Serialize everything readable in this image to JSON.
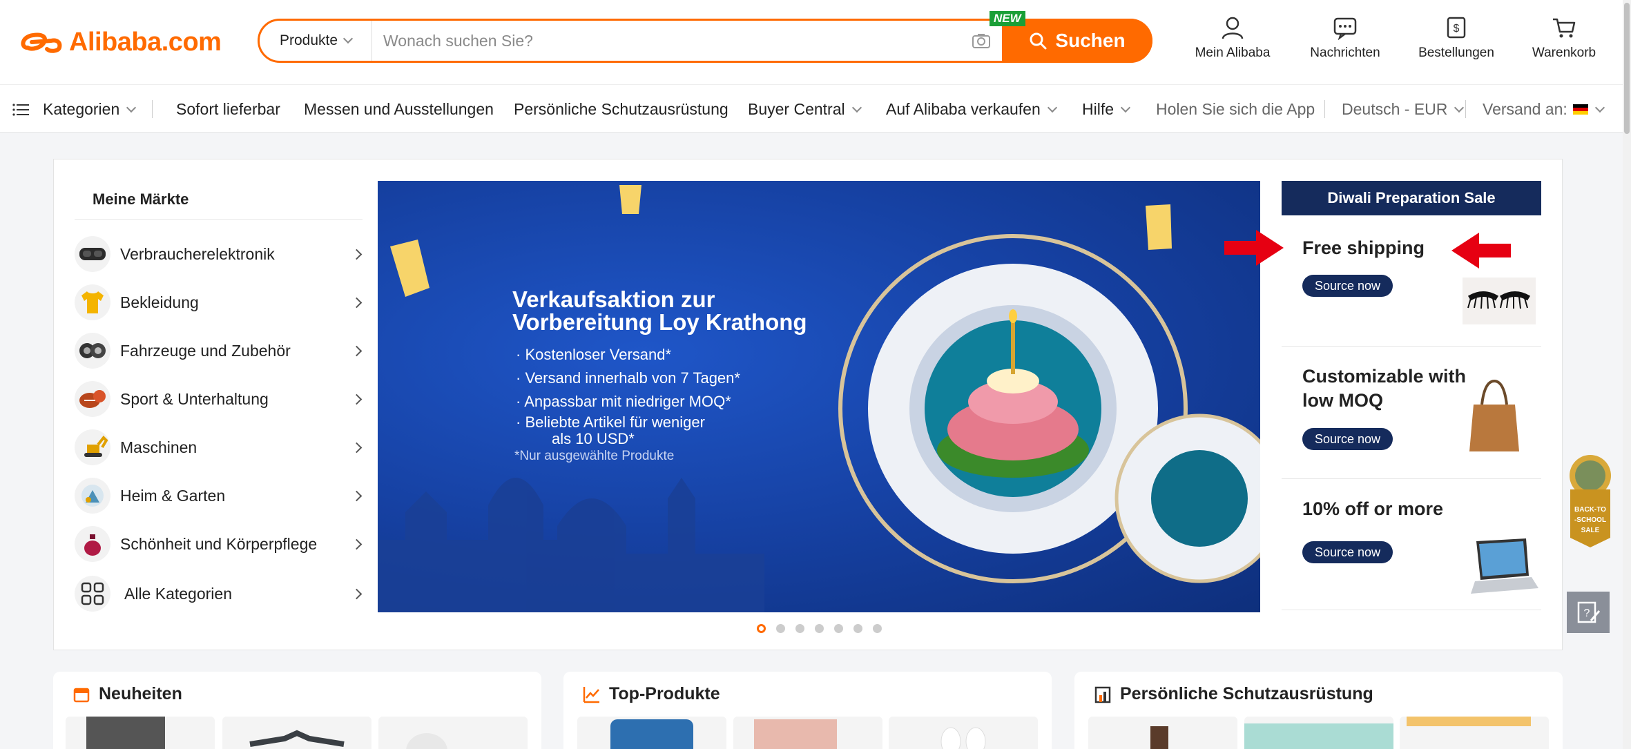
{
  "header": {
    "logo_text": "Alibaba.com",
    "search": {
      "category": "Produkte",
      "placeholder": "Wonach suchen Sie?",
      "button_label": "Suchen",
      "new_badge": "NEW"
    },
    "icons": [
      {
        "label": "Mein Alibaba",
        "icon": "user-icon"
      },
      {
        "label": "Nachrichten",
        "icon": "message-icon"
      },
      {
        "label": "Bestellungen",
        "icon": "orders-icon"
      },
      {
        "label": "Warenkorb",
        "icon": "cart-icon"
      }
    ]
  },
  "nav": {
    "categories": "Kategorien",
    "items": [
      "Sofort lieferbar",
      "Messen und Ausstellungen",
      "Persönliche Schutzausrüstung",
      "Buyer Central",
      "Auf Alibaba verkaufen",
      "Hilfe"
    ],
    "app": "Holen Sie sich die App",
    "language": "Deutsch - EUR",
    "ship_to": "Versand an:"
  },
  "markets": {
    "title": "Meine Märkte",
    "items": [
      {
        "label": "Verbraucherelektronik",
        "icon": "vr-headset-icon"
      },
      {
        "label": "Bekleidung",
        "icon": "tshirt-icon"
      },
      {
        "label": "Fahrzeuge und Zubehör",
        "icon": "tires-icon"
      },
      {
        "label": "Sport & Unterhaltung",
        "icon": "sports-balls-icon"
      },
      {
        "label": "Maschinen",
        "icon": "excavator-icon"
      },
      {
        "label": "Heim & Garten",
        "icon": "home-garden-icon"
      },
      {
        "label": "Schönheit und Körperpflege",
        "icon": "perfume-icon"
      },
      {
        "label": "Alle Kategorien",
        "icon": "grid-icon"
      }
    ]
  },
  "banner": {
    "title_line1": "Verkaufsaktion zur",
    "title_line2": "Vorbereitung Loy Krathong",
    "bullets": [
      "Kostenloser Versand*",
      "Versand innerhalb von 7 Tagen*",
      "Anpassbar mit niedriger MOQ*",
      "Beliebte Artikel für weniger",
      "als 10 USD*"
    ],
    "note": "*Nur ausgewählte Produkte",
    "slides": 7,
    "active_slide": 1
  },
  "promo": {
    "header": "Diwali Preparation Sale",
    "items": [
      {
        "title": "Free shipping",
        "button": "Source now",
        "image": "eyelashes"
      },
      {
        "title_line1": "Customizable with",
        "title_line2": "low MOQ",
        "button": "Source now",
        "image": "handbag"
      },
      {
        "title": "10% off or more",
        "button": "Source now",
        "image": "laptop"
      }
    ]
  },
  "side": {
    "badge_lines": [
      "BACK-TO",
      "-SCHOOL",
      "SALE"
    ]
  },
  "cards": [
    {
      "title": "Neuheiten",
      "icon": "new-arrivals-icon"
    },
    {
      "title": "Top-Produkte",
      "icon": "trending-icon"
    },
    {
      "title": "Persönliche Schutzausrüstung",
      "icon": "building-icon"
    }
  ],
  "colors": {
    "accent": "#ff6a00",
    "navy": "#152b5c",
    "banner_blue": "#153f9f"
  }
}
